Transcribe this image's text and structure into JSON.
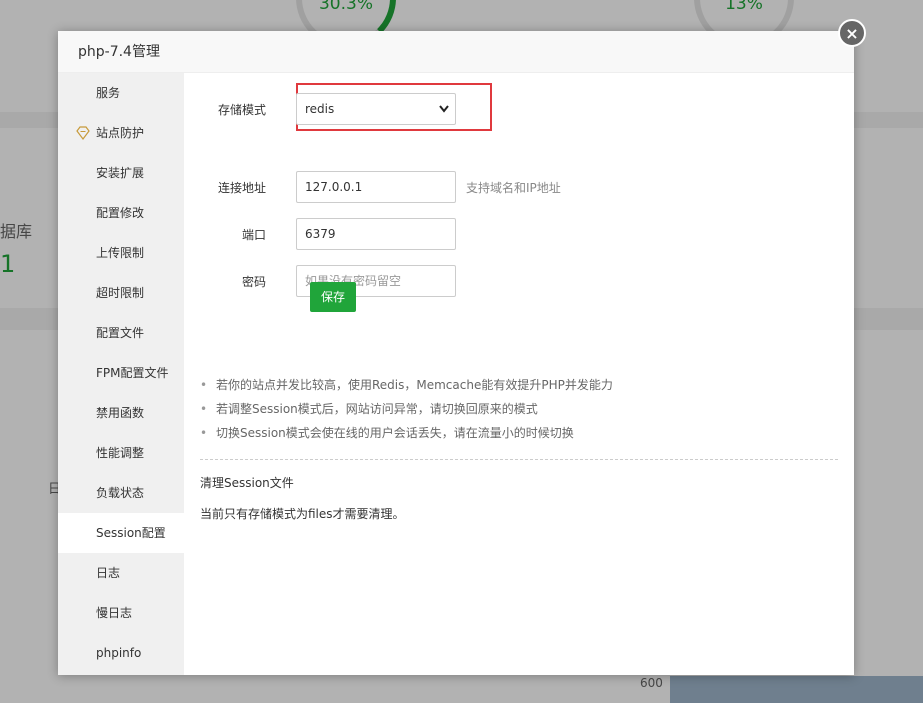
{
  "background": {
    "gauge_left_value": "30.3%",
    "gauge_right_value": "13%",
    "db_label_fragment": "据库",
    "db_count_fragment": "1",
    "day_label_fragment": "日",
    "axis_tick": "600"
  },
  "modal": {
    "title": "php-7.4管理",
    "close_label": "×"
  },
  "sidebar": {
    "items": [
      {
        "label": "服务"
      },
      {
        "label": "站点防护"
      },
      {
        "label": "安装扩展"
      },
      {
        "label": "配置修改"
      },
      {
        "label": "上传限制"
      },
      {
        "label": "超时限制"
      },
      {
        "label": "配置文件"
      },
      {
        "label": "FPM配置文件"
      },
      {
        "label": "禁用函数"
      },
      {
        "label": "性能调整"
      },
      {
        "label": "负载状态"
      },
      {
        "label": "Session配置"
      },
      {
        "label": "日志"
      },
      {
        "label": "慢日志"
      },
      {
        "label": "phpinfo"
      }
    ],
    "active_index": 11
  },
  "form": {
    "storage_mode_label": "存储模式",
    "storage_mode_value": "redis",
    "address_label": "连接地址",
    "address_value": "127.0.0.1",
    "address_hint": "支持域名和IP地址",
    "port_label": "端口",
    "port_value": "6379",
    "password_label": "密码",
    "password_placeholder": "如果没有密码留空",
    "save_label": "保存"
  },
  "tips": [
    "若你的站点并发比较高，使用Redis，Memcache能有效提升PHP并发能力",
    "若调整Session模式后，网站访问异常，请切换回原来的模式",
    "切换Session模式会使在线的用户会话丢失，请在流量小的时候切换"
  ],
  "clean_section": {
    "title": "清理Session文件",
    "note": "当前只有存储模式为files才需要清理。"
  },
  "colors": {
    "accent": "#20a53a",
    "highlight": "#e0393e"
  }
}
